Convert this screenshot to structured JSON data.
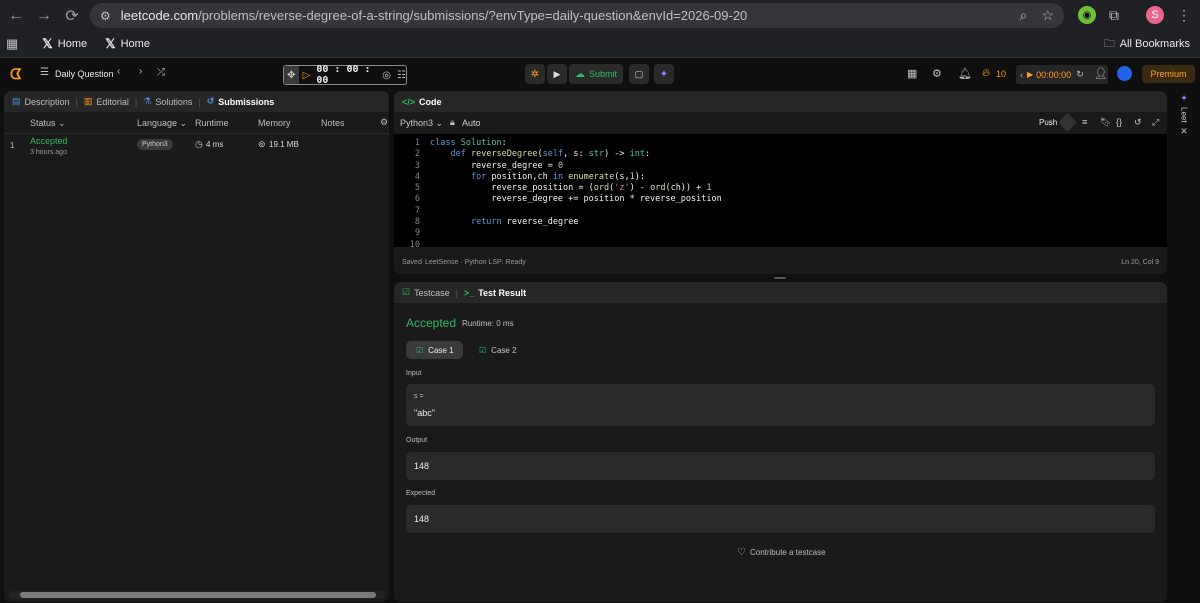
{
  "browser": {
    "url_host": "leetcode.com",
    "url_path": "/problems/reverse-degree-of-a-string/submissions/?envType=daily-question&envId=2026-09-20",
    "profile_initial": "S",
    "bookmarks": [
      "Home",
      "Home"
    ],
    "all_bookmarks": "All Bookmarks"
  },
  "header": {
    "daily_question": "Daily Question",
    "timer": "00 : 00 : 00",
    "run_label": "",
    "submit_label": "Submit",
    "streak": "10",
    "session_timer": "00:00:00",
    "premium": "Premium"
  },
  "left_panel": {
    "tabs": [
      "Description",
      "Editorial",
      "Solutions",
      "Submissions"
    ],
    "columns": [
      "Status",
      "Language",
      "Runtime",
      "Memory",
      "Notes"
    ],
    "rows": [
      {
        "index": "1",
        "status": "Accepted",
        "time": "3 hours ago",
        "language": "Python3",
        "runtime": "4 ms",
        "memory": "19.1 MB"
      }
    ]
  },
  "code_panel": {
    "title": "Code",
    "language": "Python3",
    "mode": "Auto",
    "push": "Push",
    "status_left": "Saved",
    "status_mid": "LeetSense · Python LSP: Ready",
    "status_right": "Ln 20, Col 9",
    "line_numbers": [
      "1",
      "2",
      "3",
      "4",
      "5",
      "6",
      "7",
      "8",
      "9",
      "10"
    ]
  },
  "result_panel": {
    "tabs": [
      "Testcase",
      "Test Result"
    ],
    "verdict": "Accepted",
    "runtime": "Runtime: 0 ms",
    "cases": [
      "Case 1",
      "Case 2"
    ],
    "input_label": "Input",
    "input_var": "s =",
    "input_value": "\"abc\"",
    "output_label": "Output",
    "output_value": "148",
    "expected_label": "Expected",
    "expected_value": "148",
    "contribute": "Contribute a testcase"
  },
  "side": {
    "leet_label": "Leet"
  },
  "colors": {
    "accent": "#ffa116",
    "success": "#2cbb5d",
    "panel": "#1a1a1a",
    "editor_bg": "#000000"
  }
}
